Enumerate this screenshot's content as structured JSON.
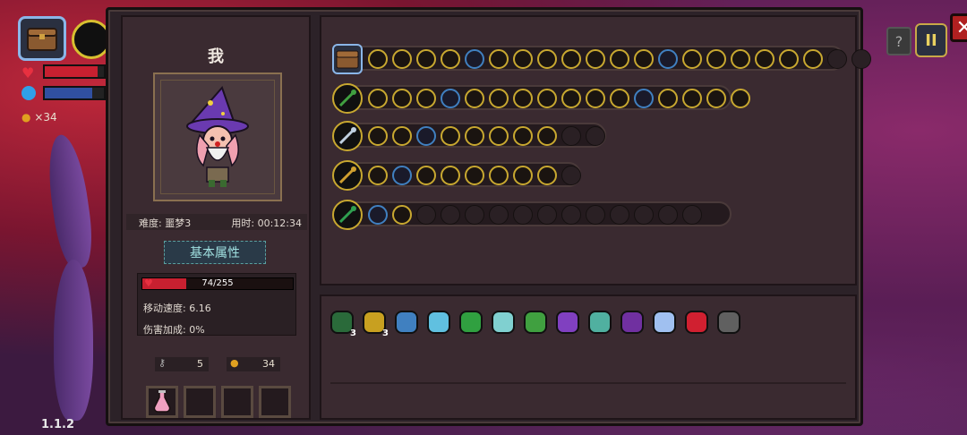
{
  "hud": {
    "coins": "×34",
    "version": "1.1.2",
    "pause_label": "II",
    "help_label": "?",
    "hp_fill": 0.9,
    "mana_fill": 0.8
  },
  "panel": {
    "close_label": "✕",
    "player_name": "我",
    "difficulty": "难度: 噩梦3",
    "time_used": "用时: 00:12:34",
    "attr_tab": "基本属性",
    "hp_text": "74/255",
    "hp_fraction": 0.29,
    "move_speed": "移动速度: 6.16",
    "damage_bonus": "伤害加成: 0%",
    "keys": "5",
    "coins": "34"
  },
  "weapon_rows": [
    {
      "name": "chest",
      "filled": 19,
      "total": 21
    },
    {
      "name": "staff-green",
      "filled": 16,
      "total": 16
    },
    {
      "name": "staff-crystal",
      "filled": 8,
      "total": 10
    },
    {
      "name": "staff-gold",
      "filled": 8,
      "total": 9
    },
    {
      "name": "staff-emerald",
      "filled": 2,
      "total": 14
    }
  ],
  "items": [
    {
      "name": "cloak",
      "color": "#2a6a3a",
      "count": "3"
    },
    {
      "name": "antler",
      "color": "#c8a020",
      "count": "3"
    },
    {
      "name": "magnifier",
      "color": "#4080c0",
      "count": ""
    },
    {
      "name": "fish",
      "color": "#60c0e0",
      "count": ""
    },
    {
      "name": "helmet",
      "color": "#30a040",
      "count": ""
    },
    {
      "name": "feather",
      "color": "#80d0d0",
      "count": ""
    },
    {
      "name": "boot",
      "color": "#40a040",
      "count": ""
    },
    {
      "name": "wizard-hat",
      "color": "#8040c0",
      "count": ""
    },
    {
      "name": "scarf",
      "color": "#50b0a0",
      "count": ""
    },
    {
      "name": "robe",
      "color": "#7030a0",
      "count": ""
    },
    {
      "name": "crystal-wing",
      "color": "#a0c0f0",
      "count": ""
    },
    {
      "name": "red-gem",
      "color": "#d02030",
      "count": ""
    },
    {
      "name": "mask",
      "color": "#606060",
      "count": ""
    }
  ]
}
